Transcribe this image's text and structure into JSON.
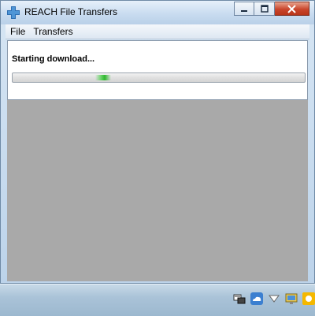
{
  "window": {
    "title": "REACH File Transfers"
  },
  "menu": {
    "items": [
      "File",
      "Transfers"
    ]
  },
  "status": {
    "text": "Starting download..."
  },
  "progress": {
    "mode": "indeterminate",
    "color": "#2fb72f"
  },
  "icons": {
    "app": "reach-app-icon",
    "minimize": "minimize-icon",
    "maximize": "maximize-icon",
    "close": "close-icon",
    "tray": [
      "network-tool-icon",
      "cloud-icon",
      "chevron-down-icon",
      "display-icon",
      "sun-icon"
    ]
  },
  "colors": {
    "close_button": "#c9452b",
    "desktop": "#a9a9a9"
  }
}
